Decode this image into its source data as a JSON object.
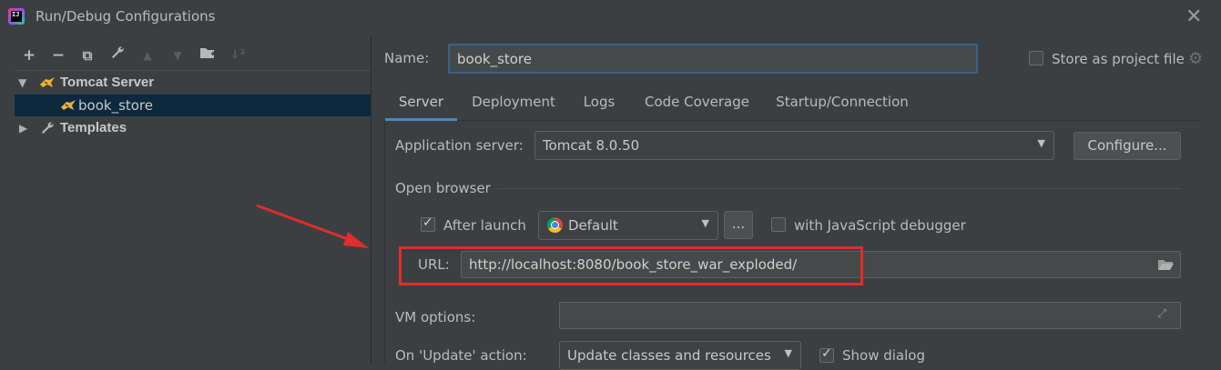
{
  "window": {
    "title": "Run/Debug Configurations",
    "close_glyph": "✕"
  },
  "toolbar": {
    "add": "+",
    "remove": "−",
    "copy": "⧉",
    "edit": "🔧",
    "move_up": "▲",
    "move_down": "▼",
    "folder": "📁",
    "sort": "↓²"
  },
  "tree": {
    "group_label": "Tomcat Server",
    "child_label": "book_store",
    "templates_label": "Templates"
  },
  "config": {
    "name_label": "Name:",
    "name_value": "book_store",
    "store_label": "Store as project file"
  },
  "tabs": [
    "Server",
    "Deployment",
    "Logs",
    "Code Coverage",
    "Startup/Connection"
  ],
  "server": {
    "app_server_label": "Application server:",
    "app_server_value": "Tomcat 8.0.50",
    "configure_button": "Configure...",
    "open_browser_label": "Open browser",
    "after_launch_label": "After launch",
    "after_launch_checked": true,
    "browser_value": "Default",
    "browse_button": "...",
    "js_debugger_label": "with JavaScript debugger",
    "js_debugger_checked": false,
    "url_label": "URL:",
    "url_value": "http://localhost:8080/book_store_war_exploded/",
    "vm_options_label": "VM options:",
    "vm_options_value": "",
    "on_update_label": "On 'Update' action:",
    "on_update_value": "Update classes and resources",
    "show_dialog_label": "Show dialog",
    "show_dialog_checked": true
  },
  "colors": {
    "background": "#3c3f41",
    "selection": "#0d293e",
    "focus_border": "#3d6185",
    "tab_underline": "#4a88c7",
    "annotation_red": "#e02d2d"
  }
}
